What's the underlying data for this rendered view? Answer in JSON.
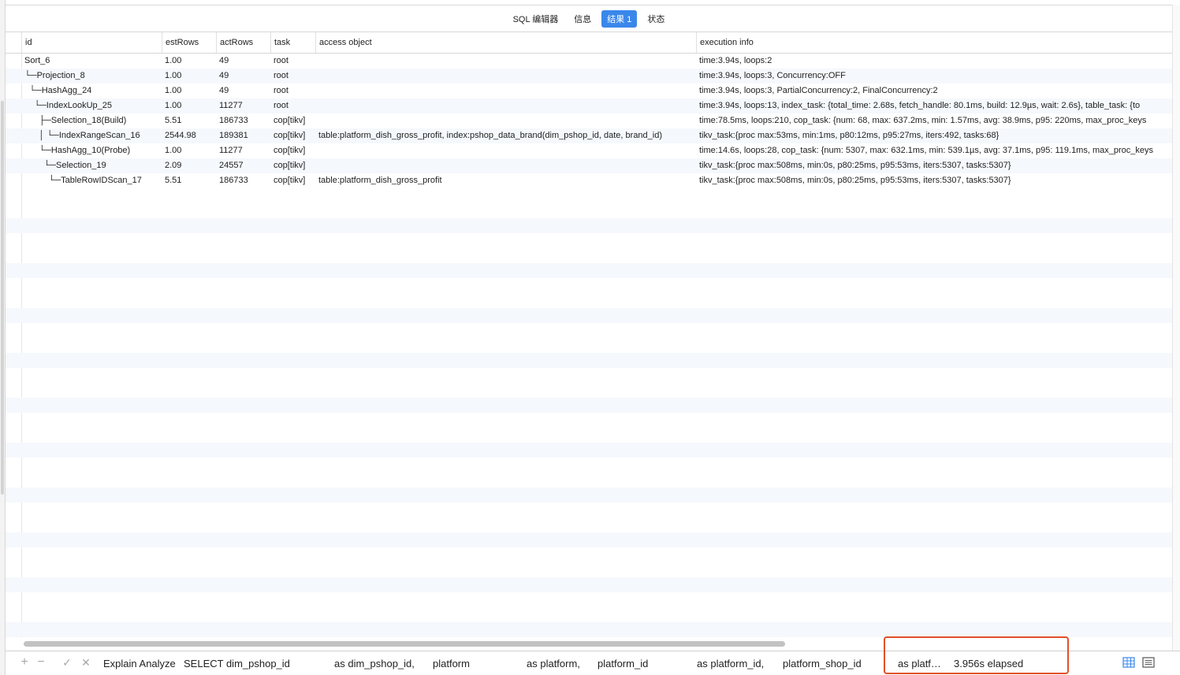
{
  "tabs": [
    "SQL 编辑器",
    "信息",
    "结果 1",
    "状态"
  ],
  "active_tab": "结果 1",
  "columns": [
    "id",
    "estRows",
    "actRows",
    "task",
    "access object",
    "execution info"
  ],
  "rows": [
    {
      "id": "Sort_6",
      "estRows": "1.00",
      "actRows": "49",
      "task": "root",
      "access_object": "",
      "execution_info": "time:3.94s, loops:2"
    },
    {
      "id": "└─Projection_8",
      "estRows": "1.00",
      "actRows": "49",
      "task": "root",
      "access_object": "",
      "execution_info": "time:3.94s, loops:3, Concurrency:OFF"
    },
    {
      "id": "  └─HashAgg_24",
      "estRows": "1.00",
      "actRows": "49",
      "task": "root",
      "access_object": "",
      "execution_info": "time:3.94s, loops:3, PartialConcurrency:2, FinalConcurrency:2"
    },
    {
      "id": "    └─IndexLookUp_25",
      "estRows": "1.00",
      "actRows": "11277",
      "task": "root",
      "access_object": "",
      "execution_info": "time:3.94s, loops:13, index_task: {total_time: 2.68s, fetch_handle: 80.1ms, build: 12.9µs, wait: 2.6s}, table_task: {to"
    },
    {
      "id": "      ├─Selection_18(Build)",
      "estRows": "5.51",
      "actRows": "186733",
      "task": "cop[tikv]",
      "access_object": "",
      "execution_info": "time:78.5ms, loops:210, cop_task: {num: 68, max: 637.2ms, min: 1.57ms, avg: 38.9ms, p95: 220ms, max_proc_keys"
    },
    {
      "id": "      │ └─IndexRangeScan_16",
      "estRows": "2544.98",
      "actRows": "189381",
      "task": "cop[tikv]",
      "access_object": "table:platform_dish_gross_profit, index:pshop_data_brand(dim_pshop_id, date, brand_id)",
      "execution_info": "tikv_task:{proc max:53ms, min:1ms, p80:12ms, p95:27ms, iters:492, tasks:68}"
    },
    {
      "id": "      └─HashAgg_10(Probe)",
      "estRows": "1.00",
      "actRows": "11277",
      "task": "cop[tikv]",
      "access_object": "",
      "execution_info": "time:14.6s, loops:28, cop_task: {num: 5307, max: 632.1ms, min: 539.1µs, avg: 37.1ms, p95: 119.1ms, max_proc_keys"
    },
    {
      "id": "        └─Selection_19",
      "estRows": "2.09",
      "actRows": "24557",
      "task": "cop[tikv]",
      "access_object": "",
      "execution_info": "tikv_task:{proc max:508ms, min:0s, p80:25ms, p95:53ms, iters:5307, tasks:5307}"
    },
    {
      "id": "          └─TableRowIDScan_17",
      "estRows": "5.51",
      "actRows": "186733",
      "task": "cop[tikv]",
      "access_object": "table:platform_dish_gross_profit",
      "execution_info": "tikv_task:{proc max:508ms, min:0s, p80:25ms, p95:53ms, iters:5307, tasks:5307}"
    }
  ],
  "status": {
    "add_icon": "plus-icon",
    "remove_icon": "minus-icon",
    "apply_icon": "check-icon",
    "discard_icon": "x-icon",
    "query_segments": [
      "Explain Analyze",
      "SELECT dim_pshop_id",
      "as dim_pshop_id,",
      "platform",
      "as platform,",
      "platform_id",
      "as platform_id,",
      "platform_shop_id",
      "as platf…"
    ],
    "elapsed": "3.956s elapsed",
    "highlight_color": "#e0502a",
    "grid_view_icon": "grid-view-icon",
    "form_view_icon": "form-view-icon"
  }
}
